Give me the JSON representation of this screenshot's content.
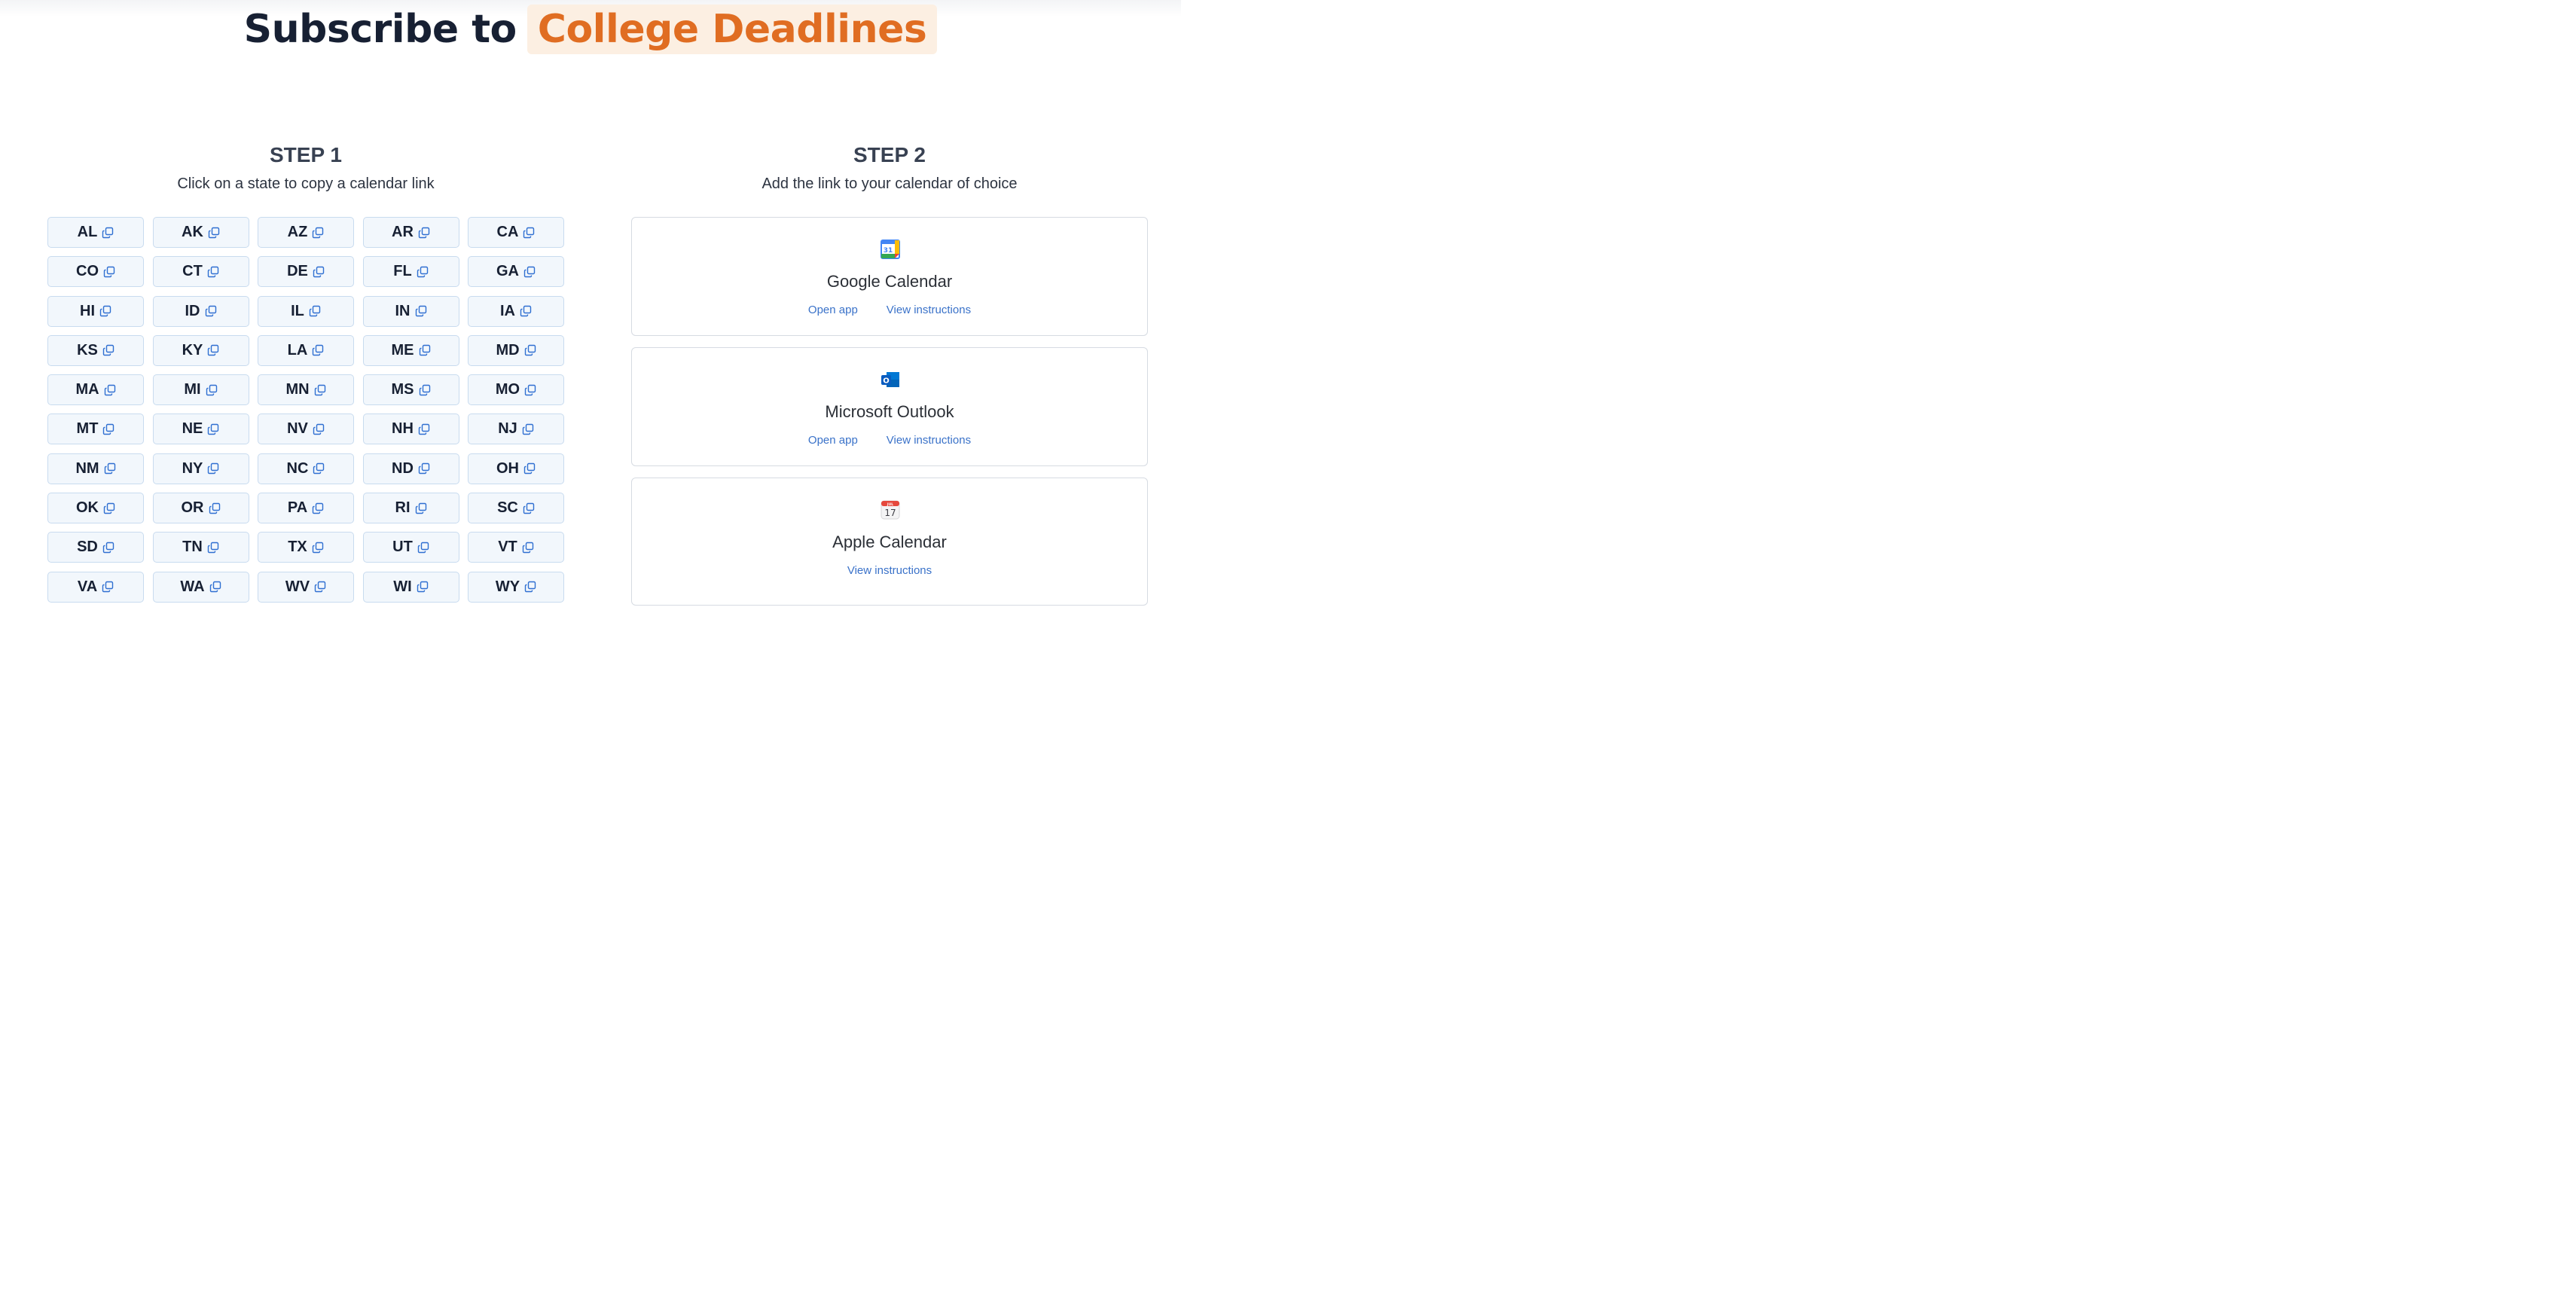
{
  "header": {
    "prefix": "Subscribe to",
    "highlight": "College Deadlines"
  },
  "step1": {
    "title": "STEP 1",
    "subtitle": "Click on a state to copy a calendar link",
    "states": [
      "AL",
      "AK",
      "AZ",
      "AR",
      "CA",
      "CO",
      "CT",
      "DE",
      "FL",
      "GA",
      "HI",
      "ID",
      "IL",
      "IN",
      "IA",
      "KS",
      "KY",
      "LA",
      "ME",
      "MD",
      "MA",
      "MI",
      "MN",
      "MS",
      "MO",
      "MT",
      "NE",
      "NV",
      "NH",
      "NJ",
      "NM",
      "NY",
      "NC",
      "ND",
      "OH",
      "OK",
      "OR",
      "PA",
      "RI",
      "SC",
      "SD",
      "TN",
      "TX",
      "UT",
      "VT",
      "VA",
      "WA",
      "WV",
      "WI",
      "WY"
    ],
    "state_icon": "copy-link-icon"
  },
  "step2": {
    "title": "STEP 2",
    "subtitle": "Add the link to your calendar of choice",
    "calendars": [
      {
        "name": "Google Calendar",
        "icon": "google-calendar-icon",
        "icon_text": "31",
        "links": [
          "Open app",
          "View instructions"
        ]
      },
      {
        "name": "Microsoft Outlook",
        "icon": "outlook-icon",
        "icon_text": "O",
        "links": [
          "Open app",
          "View instructions"
        ]
      },
      {
        "name": "Apple Calendar",
        "icon": "apple-calendar-icon",
        "icon_text": "17",
        "icon_month": "JUL",
        "links": [
          "View instructions"
        ]
      }
    ]
  },
  "colors": {
    "accent": "#e06d22",
    "accent_bg": "#fcefe2",
    "heading": "#172033",
    "link": "#3a72c9",
    "state_bg": "#f2f7fc",
    "state_border": "#c8dbef"
  }
}
